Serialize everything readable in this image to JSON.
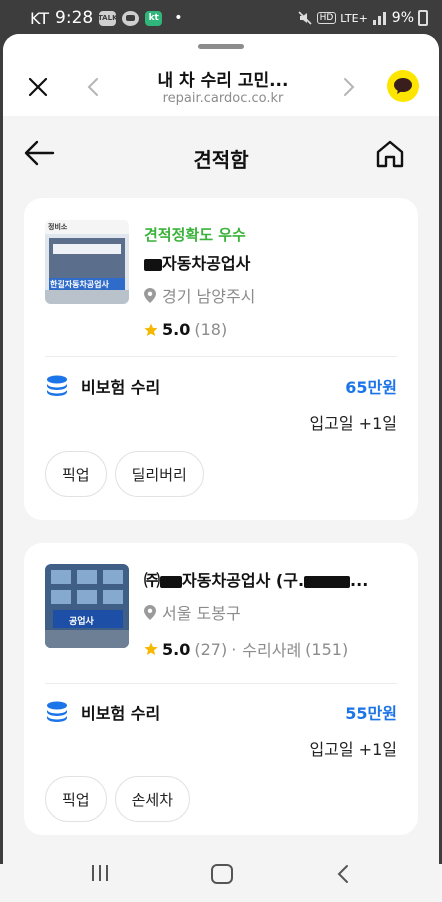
{
  "status_bar": {
    "carrier": "KT",
    "time": "9:28",
    "icons": [
      "talk-icon",
      "chat-icon",
      "kt-app-icon"
    ],
    "talk_label": "TALK",
    "kt_label": "kt",
    "dot": "•",
    "network": "LTE+",
    "battery": "9%"
  },
  "browser": {
    "title": "내 차 수리 고민...",
    "url": "repair.cardoc.co.kr"
  },
  "header": {
    "title": "견적함"
  },
  "quotes": [
    {
      "badge": "견적정확도 우수",
      "name": "자동차공업사",
      "location": "경기 남양주시",
      "rating": "5.0",
      "review_count": "(18)",
      "service": "비보험 수리",
      "price": "65만원",
      "eta": "입고일 +1일",
      "chips": [
        "픽업",
        "딜리버리"
      ],
      "thumb_sign": "한길자동차공업사",
      "thumb_top": "정비소"
    },
    {
      "name_prefix": "㈜",
      "name": "자동차공업사 (구.",
      "name_suffix": "...",
      "location": "서울 도봉구",
      "rating": "5.0",
      "review_count": "(27)",
      "separator": "·",
      "cases_label": "수리사례",
      "cases_count": "(151)",
      "service": "비보험 수리",
      "price": "55만원",
      "eta": "입고일 +1일",
      "chips": [
        "픽업",
        "손세차"
      ],
      "thumb_sign": "공업사"
    }
  ],
  "colors": {
    "accent_green": "#3bb33b",
    "price_blue": "#1b74e8",
    "kakao_yellow": "#fee500",
    "star": "#f5b800"
  }
}
